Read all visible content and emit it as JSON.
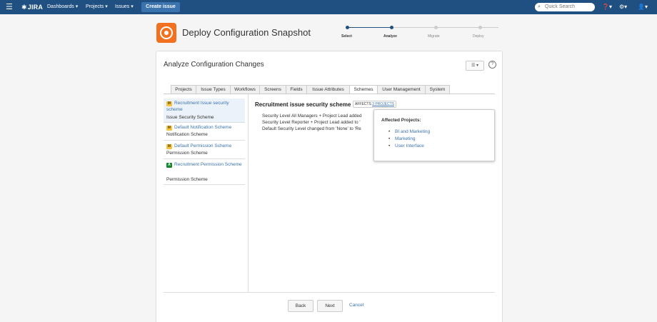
{
  "topbar": {
    "logo_text": "JIRA",
    "nav": [
      "Dashboards",
      "Projects",
      "Issues"
    ],
    "create_label": "Create issue",
    "search_placeholder": "Quick Search"
  },
  "header": {
    "title": "Deploy Configuration Snapshot",
    "steps": [
      {
        "label": "Select",
        "state": "done"
      },
      {
        "label": "Analyze",
        "state": "current"
      },
      {
        "label": "Migrate",
        "state": "pending"
      },
      {
        "label": "Deploy",
        "state": "pending"
      }
    ]
  },
  "card": {
    "title": "Analyze Configuration Changes",
    "tabs": [
      "Projects",
      "Issue Types",
      "Workflows",
      "Screens",
      "Fields",
      "Issue Attributes",
      "Schemes",
      "User Management",
      "System"
    ],
    "active_tab": "Schemes"
  },
  "schemes": [
    {
      "badge": "M",
      "name": "Recruitment Issue security scheme",
      "type": "Issue Security Scheme",
      "selected": true
    },
    {
      "badge": "M",
      "name": "Default Notification Scheme",
      "type": "Notification Scheme",
      "selected": false
    },
    {
      "badge": "M",
      "name": "Default Permission Scheme",
      "type": "Permission Scheme",
      "selected": false
    },
    {
      "badge": "A",
      "name": "Recruitment Permission Scheme",
      "type": "Permission Scheme",
      "selected": false
    }
  ],
  "detail": {
    "title": "Recruitment issue security scheme",
    "affects_label": "AFFECTS",
    "affects_link": "3 PROJECTS",
    "changes": [
      "Security Level All Managers + Project Lead added",
      "Security Level Reporter + Project Lead added to '",
      "Default Security Level changed from 'None' to 'Re"
    ]
  },
  "popup": {
    "title": "Affected Projects:",
    "projects": [
      "BI and Marketing",
      "Marketing",
      "User Interface"
    ]
  },
  "footer": {
    "back_label": "Back",
    "next_label": "Next",
    "cancel_label": "Cancel"
  },
  "colors": {
    "topbar": "#205081",
    "link": "#3b73af",
    "step_active": "#205081",
    "step_pending": "#cccccc",
    "app_icon": "#f17121"
  }
}
